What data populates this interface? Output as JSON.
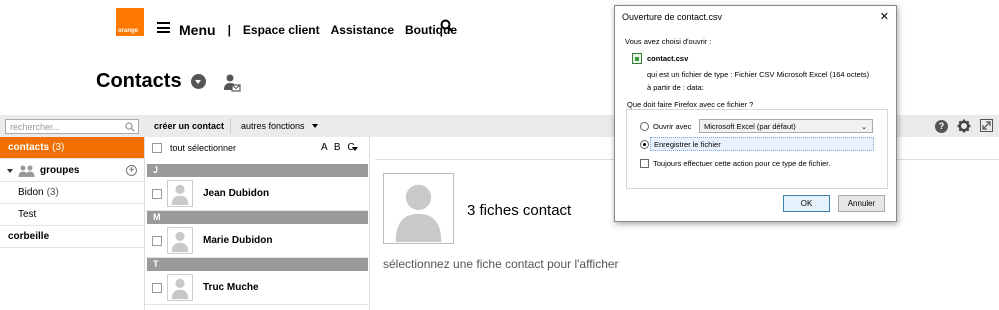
{
  "header": {
    "logo_text": "orange",
    "menu_label": "Menu",
    "separator": "|",
    "nav_links": [
      "Espace client",
      "Assistance",
      "Boutique"
    ]
  },
  "page": {
    "title": "Contacts"
  },
  "toolbar": {
    "search_placeholder": "rechercher...",
    "create_label": "créer un contact",
    "more_label": "autres fonctions",
    "help_label": "?"
  },
  "sidebar": {
    "contacts_label": "contacts",
    "contacts_count": "(3)",
    "groups_label": "groupes",
    "group_items": [
      {
        "label": "Bidon",
        "count": "(3)"
      },
      {
        "label": "Test",
        "count": ""
      }
    ],
    "trash_label": "corbeille"
  },
  "list": {
    "select_all_label": "tout sélectionner",
    "sort_label": "A B C",
    "sections": [
      {
        "letter": "J",
        "name": "Jean Dubidon"
      },
      {
        "letter": "M",
        "name": "Marie Dubidon"
      },
      {
        "letter": "T",
        "name": "Truc Muche"
      }
    ]
  },
  "main": {
    "count_text": "3 fiches contact",
    "hint_text": "sélectionnez une fiche contact pour l'afficher"
  },
  "dialog": {
    "title": "Ouverture de contact.csv",
    "close": "✕",
    "intro": "Vous avez choisi d'ouvrir :",
    "filename": "contact.csv",
    "type_line": "qui est un fichier de type :  Fichier CSV Microsoft Excel (164 octets)",
    "from_line": "à partir de :  data:",
    "question": "Que doit faire Firefox avec ce fichier ?",
    "open_with_label": "Ouvrir avec",
    "open_with_value": "Microsoft Excel (par défaut)",
    "save_label": "Enregistrer le fichier",
    "always_label": "Toujours effectuer cette action pour ce type de fichier.",
    "ok_label": "OK",
    "cancel_label": "Annuler"
  },
  "colors": {
    "brand": "#ff7900",
    "active": "#f16e00",
    "letter_bar": "#9a9a9a"
  }
}
